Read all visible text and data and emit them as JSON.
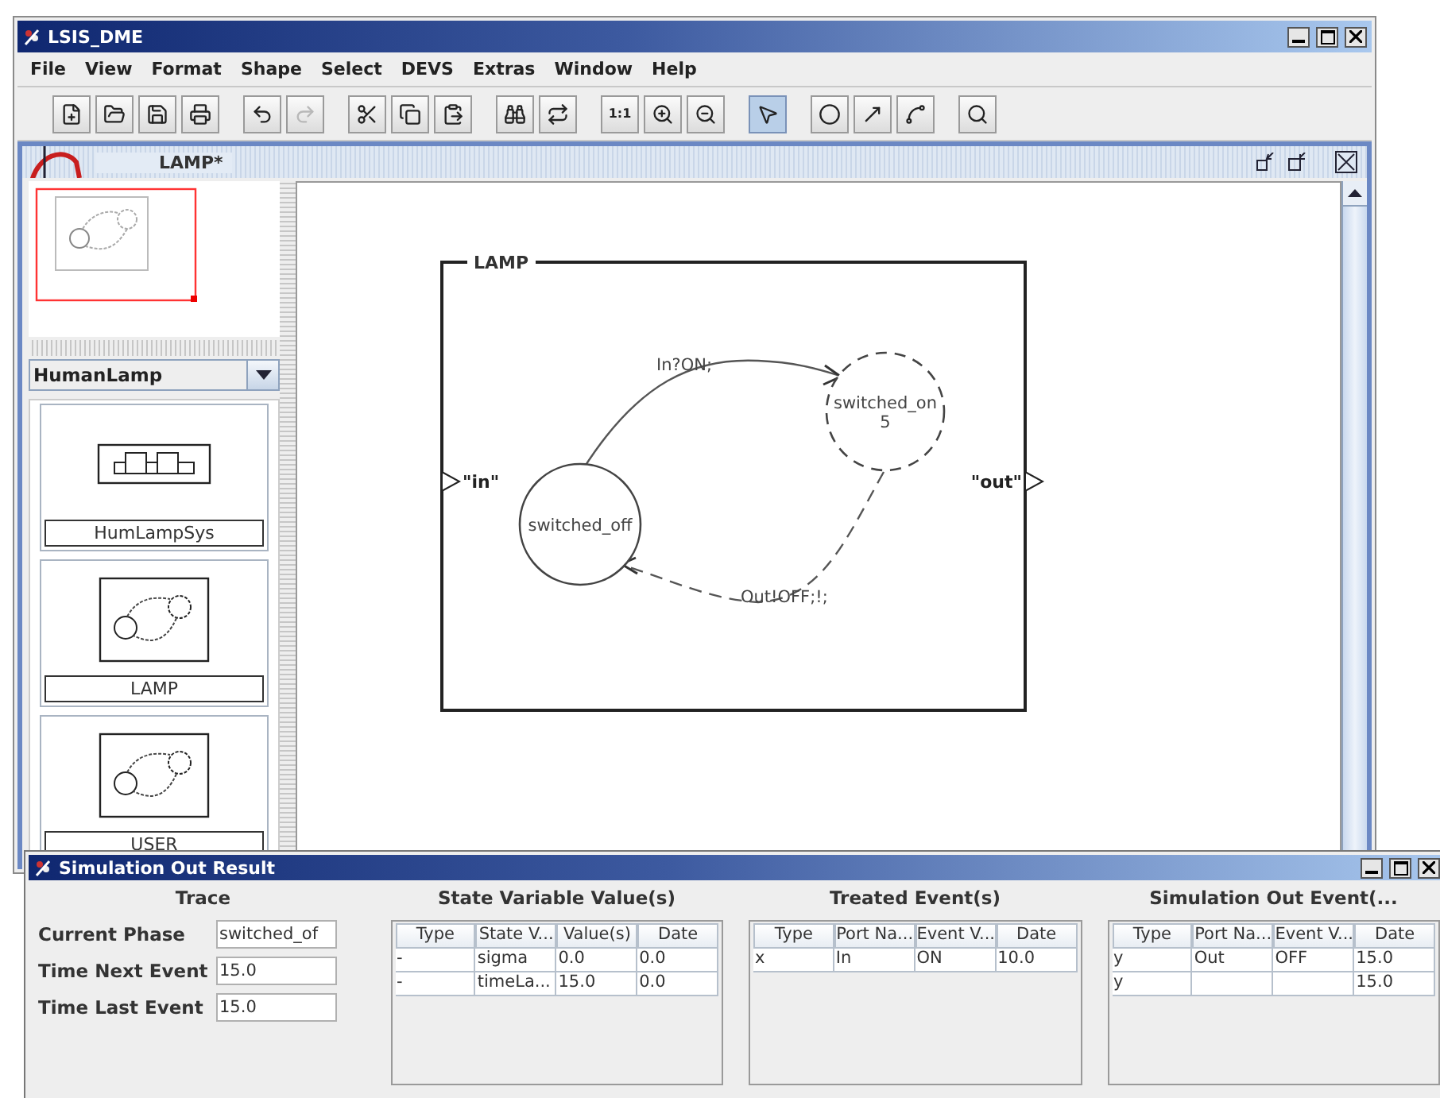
{
  "window": {
    "title": "LSIS_DME"
  },
  "menu": [
    {
      "label": "File"
    },
    {
      "label": "View"
    },
    {
      "label": "Format"
    },
    {
      "label": "Shape"
    },
    {
      "label": "Select"
    },
    {
      "label": "DEVS"
    },
    {
      "label": "Extras"
    },
    {
      "label": "Window"
    },
    {
      "label": "Help"
    }
  ],
  "toolbar": [
    {
      "buttons": [
        {
          "kind": "new",
          "selected": false,
          "disabled": false
        },
        {
          "kind": "open",
          "selected": false,
          "disabled": false
        },
        {
          "kind": "save",
          "selected": false,
          "disabled": false
        },
        {
          "kind": "print",
          "selected": false,
          "disabled": false
        }
      ]
    },
    {
      "buttons": [
        {
          "kind": "undo",
          "selected": false,
          "disabled": false
        },
        {
          "kind": "redo",
          "selected": false,
          "disabled": true
        }
      ]
    },
    {
      "buttons": [
        {
          "kind": "cut",
          "selected": false,
          "disabled": false
        },
        {
          "kind": "copy",
          "selected": false,
          "disabled": false
        },
        {
          "kind": "paste",
          "selected": false,
          "disabled": false
        }
      ]
    },
    {
      "buttons": [
        {
          "kind": "find",
          "selected": false,
          "disabled": false
        },
        {
          "kind": "replace",
          "selected": false,
          "disabled": false
        }
      ]
    },
    {
      "buttons": [
        {
          "kind": "actual-size",
          "label": "1:1",
          "selected": false,
          "disabled": false
        },
        {
          "kind": "zoom-in",
          "selected": false,
          "disabled": false
        },
        {
          "kind": "zoom-out",
          "selected": false,
          "disabled": false
        }
      ]
    },
    {
      "buttons": [
        {
          "kind": "pointer",
          "selected": true,
          "disabled": false
        }
      ]
    },
    {
      "buttons": [
        {
          "kind": "ellipse",
          "selected": false,
          "disabled": false
        },
        {
          "kind": "arrow",
          "selected": false,
          "disabled": false
        },
        {
          "kind": "curve",
          "selected": false,
          "disabled": false
        }
      ]
    },
    {
      "buttons": [
        {
          "kind": "zoom",
          "selected": false,
          "disabled": false
        }
      ]
    }
  ],
  "document": {
    "title": "LAMP*"
  },
  "library": {
    "value": "HumanLamp",
    "items": [
      {
        "label": "HumLampSys",
        "kind": "coupled"
      },
      {
        "label": "LAMP",
        "kind": "atomic"
      },
      {
        "label": "USER",
        "kind": "atomic"
      }
    ]
  },
  "diagram": {
    "model": "LAMP",
    "ports": [
      {
        "label": "\"in\"",
        "kind": "input"
      },
      {
        "label": "\"out\"",
        "kind": "output"
      }
    ],
    "states": [
      {
        "name": "switched_off",
        "dashed": false
      },
      {
        "name": "switched_on",
        "time": "5",
        "dashed": true
      }
    ],
    "transitions": [
      {
        "label": "In?ON;",
        "dashed": false
      },
      {
        "label": "Out!OFF;!;",
        "dashed": true
      }
    ]
  },
  "simulation": {
    "title": "Simulation Out Result",
    "trace": {
      "heading": "Trace",
      "fields": [
        {
          "label": "Current Phase",
          "value": "switched_of"
        },
        {
          "label": "Time Next Event",
          "value": "15.0"
        },
        {
          "label": "Time Last Event",
          "value": "15.0"
        }
      ]
    },
    "tables": [
      {
        "heading": "State Variable Value(s)",
        "columns": [
          "Type",
          "State V...",
          "Value(s)",
          "Date"
        ],
        "rows": [
          [
            "-",
            "sigma",
            "0.0",
            "0.0"
          ],
          [
            "-",
            "timeLa...",
            "15.0",
            "0.0"
          ]
        ]
      },
      {
        "heading": "Treated Event(s)",
        "columns": [
          "Type",
          "Port Na...",
          "Event V...",
          "Date"
        ],
        "rows": [
          [
            "x",
            "In",
            "ON",
            "10.0"
          ]
        ]
      },
      {
        "heading": "Simulation Out Event(...",
        "columns": [
          "Type",
          "Port Na...",
          "Event V...",
          "Date"
        ],
        "rows": [
          [
            "y",
            "Out",
            "OFF",
            "15.0"
          ],
          [
            "y",
            "",
            "",
            "15.0"
          ]
        ]
      }
    ]
  }
}
